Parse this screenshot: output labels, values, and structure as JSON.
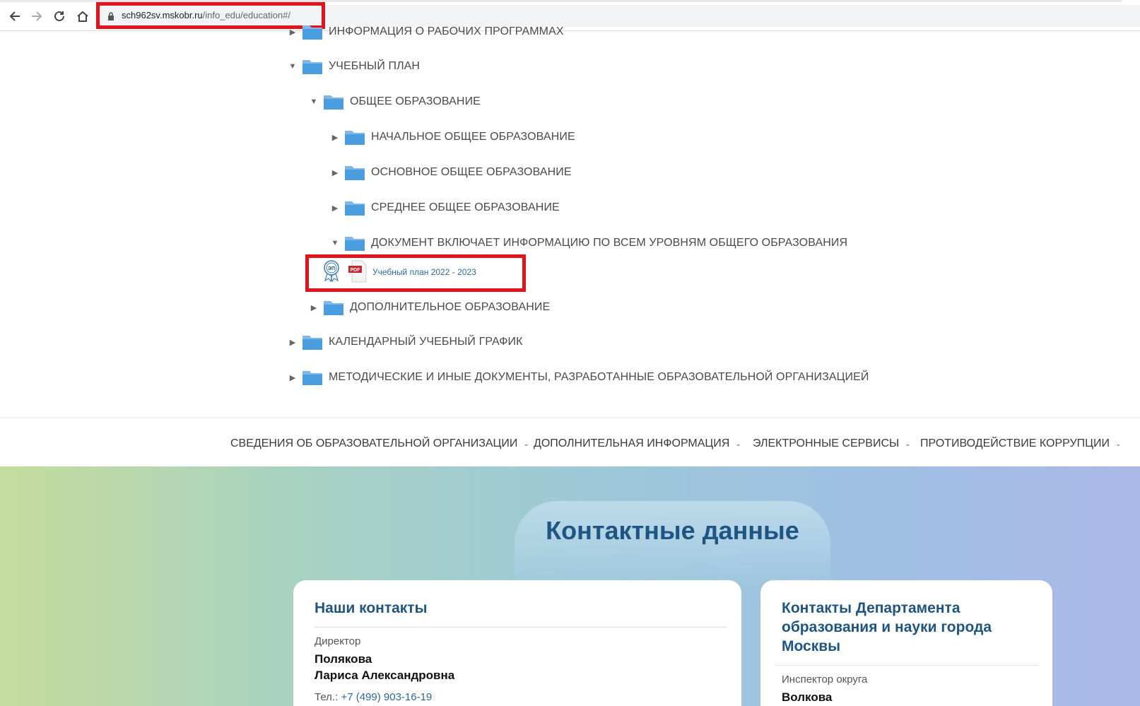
{
  "browser": {
    "url_domain": "sch962sv.mskobr.ru",
    "url_path": "/info_edu/education#/"
  },
  "tree": {
    "items": [
      {
        "label": "ИНФОРМАЦИЯ О РАБОЧИХ ПРОГРАММАХ",
        "state": "collapsed"
      },
      {
        "label": "УЧЕБНЫЙ ПЛАН",
        "state": "expanded"
      },
      {
        "label": "ОБЩЕЕ ОБРАЗОВАНИЕ",
        "state": "expanded"
      },
      {
        "label": "НАЧАЛЬНОЕ ОБЩЕЕ ОБРАЗОВАНИЕ",
        "state": "collapsed"
      },
      {
        "label": "ОСНОВНОЕ ОБЩЕЕ ОБРАЗОВАНИЕ",
        "state": "collapsed"
      },
      {
        "label": "СРЕДНЕЕ ОБЩЕЕ ОБРАЗОВАНИЕ",
        "state": "collapsed"
      },
      {
        "label": "ДОКУМЕНТ ВКЛЮЧАЕТ ИНФОРМАЦИЮ ПО ВСЕМ УРОВНЯМ ОБЩЕГО ОБРАЗОВАНИЯ",
        "state": "expanded"
      },
      {
        "label": "ДОПОЛНИТЕЛЬНОЕ ОБРАЗОВАНИЕ",
        "state": "collapsed"
      },
      {
        "label": "КАЛЕНДАРНЫЙ УЧЕБНЫЙ ГРАФИК",
        "state": "collapsed"
      },
      {
        "label": "МЕТОДИЧЕСКИЕ И ИНЫЕ ДОКУМЕНТЫ, РАЗРАБОТАННЫЕ ОБРАЗОВАТЕЛЬНОЙ ОРГАНИЗАЦИЕЙ",
        "state": "collapsed"
      }
    ],
    "document": {
      "sign_badge": "ЭП",
      "file_type": "PDF",
      "title": "Учебный план 2022 - 2023"
    }
  },
  "menu": {
    "items": [
      "СВЕДЕНИЯ ОБ ОБРАЗОВАТЕЛЬНОЙ ОРГАНИЗАЦИИ",
      "ДОПОЛНИТЕЛЬНАЯ ИНФОРМАЦИЯ",
      "ЭЛЕКТРОННЫЕ СЕРВИСЫ",
      "ПРОТИВОДЕЙСТВИЕ КОРРУПЦИИ"
    ],
    "chevron": "⌄"
  },
  "contacts": {
    "title": "Контактные данные",
    "our": {
      "title": "Наши контакты",
      "role": "Директор",
      "name_line1": "Полякова",
      "name_line2": "Лариса Александровна",
      "tel_label": "Тел.:",
      "tel": "+7 (499) 903-16-19"
    },
    "department": {
      "title_line1": "Контакты Департамента",
      "title_line2": "образования и науки города",
      "title_line3": "Москвы",
      "role": "Инспектор округа",
      "name_line1": "Волкова"
    }
  },
  "colors": {
    "highlight": "#e2141b",
    "link": "#2a6a9b",
    "heading": "#1e5582"
  }
}
